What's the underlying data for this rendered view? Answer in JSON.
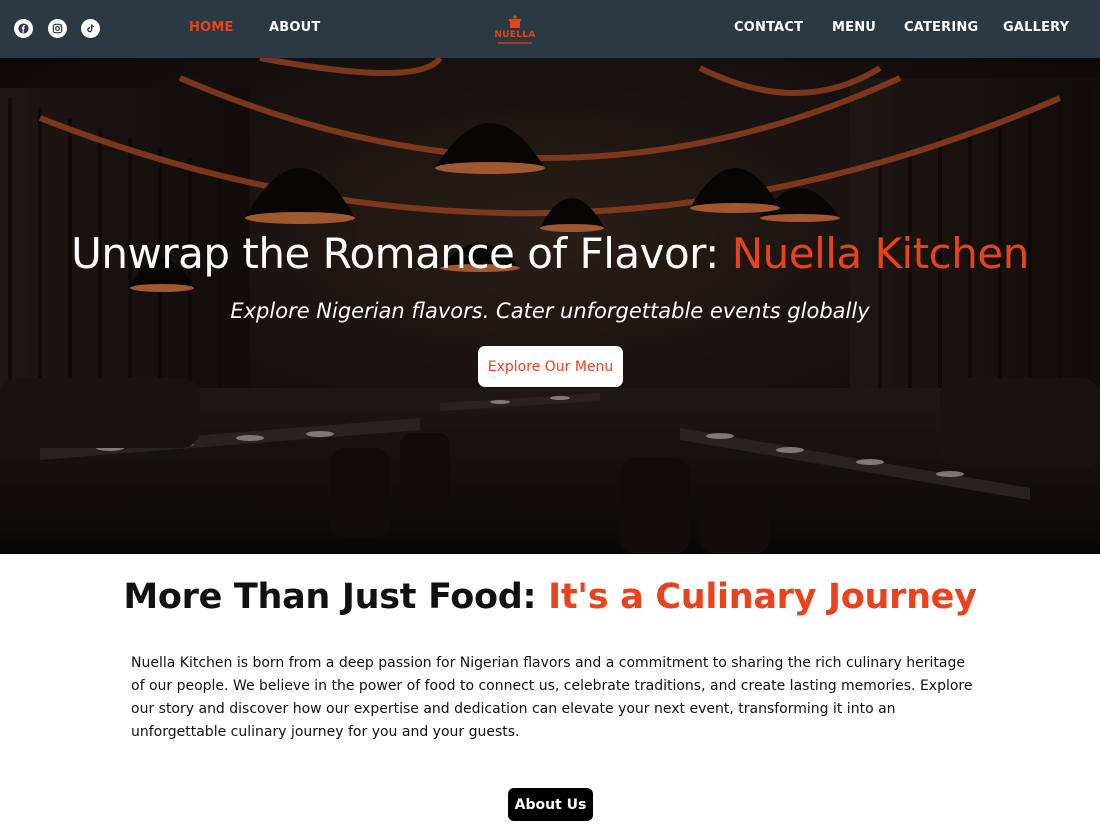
{
  "nav": {
    "social": [
      {
        "icon": "facebook-icon"
      },
      {
        "icon": "instagram-icon"
      },
      {
        "icon": "tiktok-icon"
      }
    ],
    "links_left": [
      "HOME",
      "ABOUT"
    ],
    "links_right": [
      "CONTACT",
      "MENU",
      "CATERING",
      "GALLERY"
    ],
    "active": "HOME",
    "logo_text": "NUELLA"
  },
  "hero": {
    "title_main": "Unwrap the Romance of Flavor: ",
    "title_accent": "Nuella Kitchen",
    "subtitle": "Explore Nigerian flavors. Cater unforgettable events globally",
    "cta_label": "Explore Our Menu"
  },
  "about": {
    "title_main": "More Than Just Food: ",
    "title_accent": "It's a Culinary Journey",
    "body": "Nuella Kitchen is born from a deep passion for Nigerian flavors and a commitment to sharing the rich culinary heritage of our people. We believe in the power of food to connect us, celebrate traditions, and create lasting memories. Explore our story and discover how our expertise and dedication can elevate your next event, transforming it into an unforgettable culinary journey for you and your guests.",
    "cta_label": "About Us"
  },
  "colors": {
    "nav_bg": "#2a3942",
    "accent": "#e8431b",
    "text_dark": "#111111",
    "button_dark": "#000000"
  }
}
